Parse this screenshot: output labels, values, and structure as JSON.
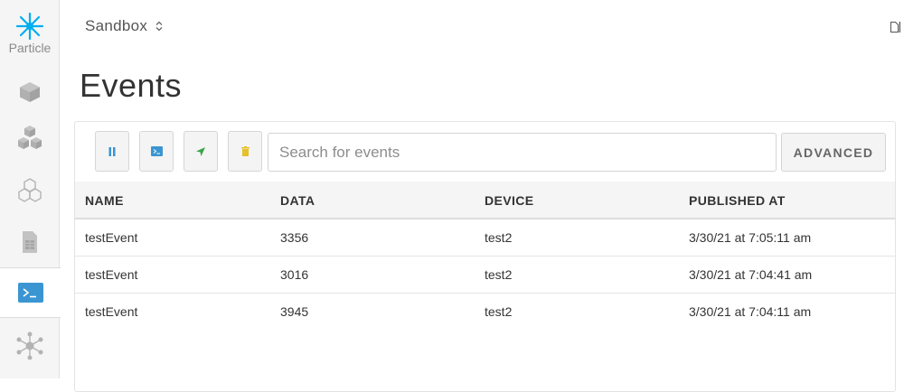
{
  "brand": {
    "name": "Particle",
    "color": "#00aeef"
  },
  "sidebar": {
    "items": [
      {
        "icon": "cube-icon",
        "active": false
      },
      {
        "icon": "cubes-icon",
        "active": false
      },
      {
        "icon": "hexagons-icon",
        "active": false
      },
      {
        "icon": "sim-card-icon",
        "active": false
      },
      {
        "icon": "terminal-icon",
        "active": true
      },
      {
        "icon": "network-icon",
        "active": false
      }
    ]
  },
  "header": {
    "org_name": "Sandbox"
  },
  "page": {
    "title": "Events"
  },
  "toolbar": {
    "buttons": [
      {
        "icon": "pause-icon",
        "color": "#3a95d2"
      },
      {
        "icon": "terminal-icon",
        "color": "#3a95d2"
      },
      {
        "icon": "send-icon",
        "color": "#37a548"
      },
      {
        "icon": "trash-icon",
        "color": "#e5c12a"
      }
    ],
    "search_placeholder": "Search for events",
    "search_value": "",
    "advanced_label": "ADVANCED"
  },
  "table": {
    "columns": [
      "NAME",
      "DATA",
      "DEVICE",
      "PUBLISHED AT"
    ],
    "rows": [
      {
        "name": "testEvent",
        "data": "3356",
        "device": "test2",
        "published_at": "3/30/21 at 7:05:11 am"
      },
      {
        "name": "testEvent",
        "data": "3016",
        "device": "test2",
        "published_at": "3/30/21 at 7:04:41 am"
      },
      {
        "name": "testEvent",
        "data": "3945",
        "device": "test2",
        "published_at": "3/30/21 at 7:04:11 am"
      }
    ]
  }
}
